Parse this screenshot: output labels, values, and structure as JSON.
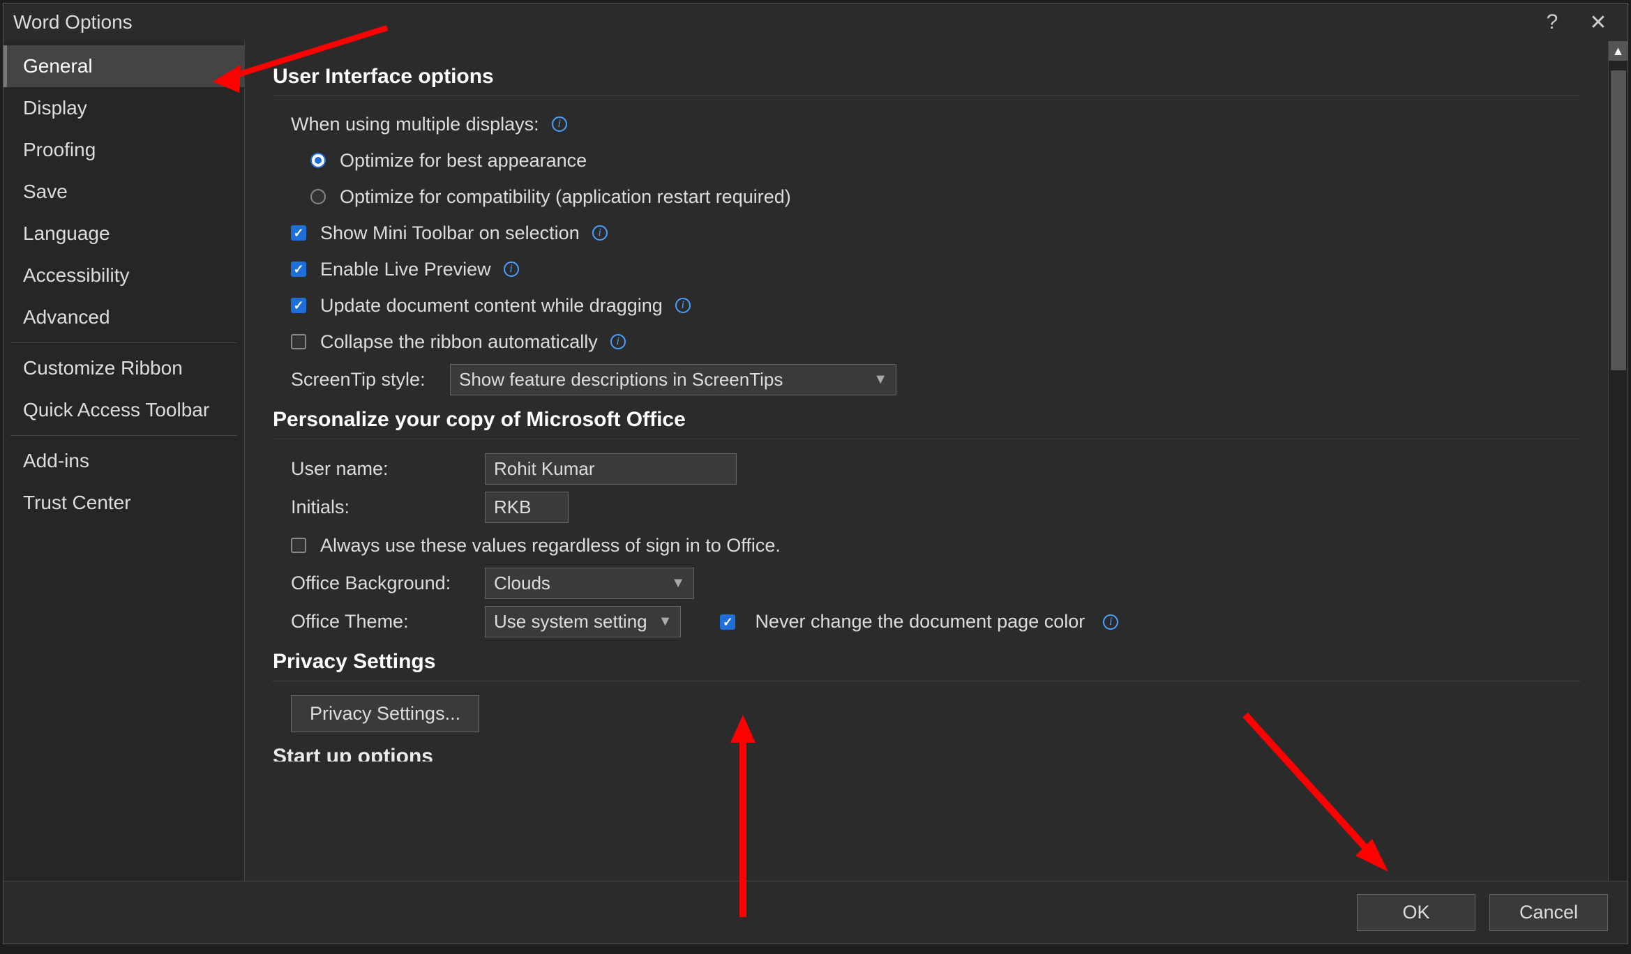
{
  "title": "Word Options",
  "sidebar": {
    "items": [
      {
        "label": "General",
        "selected": true
      },
      {
        "label": "Display"
      },
      {
        "label": "Proofing"
      },
      {
        "label": "Save"
      },
      {
        "label": "Language"
      },
      {
        "label": "Accessibility"
      },
      {
        "label": "Advanced"
      },
      {
        "label": "Customize Ribbon",
        "sepBefore": true
      },
      {
        "label": "Quick Access Toolbar"
      },
      {
        "label": "Add-ins",
        "sepBefore": true
      },
      {
        "label": "Trust Center"
      }
    ]
  },
  "sections": {
    "ui": {
      "heading": "User Interface options",
      "multidisplay_label": "When using multiple displays:",
      "radio_appearance": "Optimize for best appearance",
      "radio_compat": "Optimize for compatibility (application restart required)",
      "chk_minitoolbar": "Show Mini Toolbar on selection",
      "chk_livepreview": "Enable Live Preview",
      "chk_updatecontent": "Update document content while dragging",
      "chk_collapseribbon": "Collapse the ribbon automatically",
      "screentip_label": "ScreenTip style:",
      "screentip_value": "Show feature descriptions in ScreenTips"
    },
    "personalize": {
      "heading": "Personalize your copy of Microsoft Office",
      "username_label": "User name:",
      "username_value": "Rohit Kumar",
      "initials_label": "Initials:",
      "initials_value": "RKB",
      "chk_always": "Always use these values regardless of sign in to Office.",
      "bg_label": "Office Background:",
      "bg_value": "Clouds",
      "theme_label": "Office Theme:",
      "theme_value": "Use system setting",
      "chk_neverchange": "Never change the document page color"
    },
    "privacy": {
      "heading": "Privacy Settings",
      "button": "Privacy Settings..."
    },
    "startup_partial": "Start up options"
  },
  "footer": {
    "ok": "OK",
    "cancel": "Cancel"
  },
  "titlebar": {
    "help": "?",
    "close": "✕"
  }
}
